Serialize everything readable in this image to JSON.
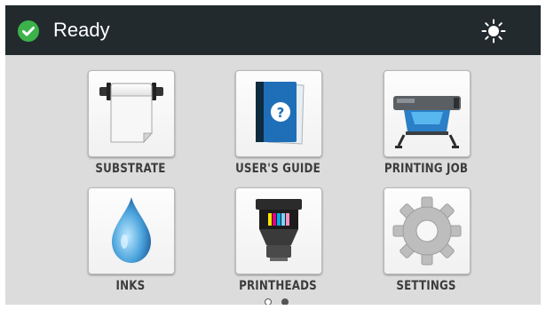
{
  "status": {
    "text": "Ready",
    "icon": "check-circle-icon",
    "color": "#3bb34a"
  },
  "header_icons": {
    "brightness": "brightness-icon"
  },
  "tiles": [
    {
      "label": "SUBSTRATE",
      "icon": "substrate-roll-icon"
    },
    {
      "label": "USER'S GUIDE",
      "icon": "users-guide-book-icon"
    },
    {
      "label": "PRINTING JOB",
      "icon": "printer-icon"
    },
    {
      "label": "INKS",
      "icon": "ink-drop-icon"
    },
    {
      "label": "PRINTHEADS",
      "icon": "printhead-icon"
    },
    {
      "label": "SETTINGS",
      "icon": "gear-icon"
    }
  ],
  "pagination": {
    "pages": 2,
    "current": 1
  }
}
